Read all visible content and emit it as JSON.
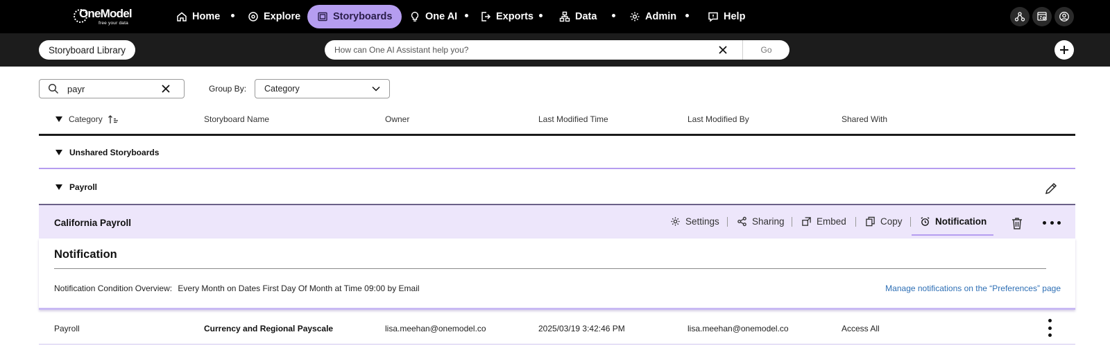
{
  "brand": {
    "name": "OneModel",
    "tagline": "free your data"
  },
  "nav": {
    "items": [
      {
        "label": "Home",
        "icon": "home-icon"
      },
      {
        "label": "Explore",
        "icon": "compass-icon"
      },
      {
        "label": "Storyboards",
        "icon": "storyboard-icon",
        "active": true
      },
      {
        "label": "One AI",
        "icon": "lightbulb-icon"
      },
      {
        "label": "Exports",
        "icon": "export-icon"
      },
      {
        "label": "Data",
        "icon": "hierarchy-icon"
      },
      {
        "label": "Admin",
        "icon": "gear-icon"
      },
      {
        "label": "Help",
        "icon": "help-chat-icon"
      }
    ],
    "right_icons": [
      "users-network-icon",
      "dashboard-settings-icon",
      "user-profile-icon"
    ]
  },
  "subbar": {
    "library_button": "Storyboard Library",
    "ai_placeholder": "How can One AI Assistant help you?",
    "go_label": "Go"
  },
  "filters": {
    "search_value": "payr",
    "group_by_label": "Group By:",
    "group_by_value": "Category"
  },
  "table": {
    "columns": [
      "Category",
      "Storyboard Name",
      "Owner",
      "Last Modified Time",
      "Last Modified By",
      "Shared With"
    ]
  },
  "groups": {
    "unshared": "Unshared Storyboards",
    "payroll": "Payroll"
  },
  "expanded": {
    "title": "California Payroll",
    "actions": {
      "settings": "Settings",
      "sharing": "Sharing",
      "embed": "Embed",
      "copy": "Copy",
      "notification": "Notification"
    },
    "section_title": "Notification",
    "overview_label": "Notification Condition Overview:",
    "overview_value": "Every Month on Dates First Day Of Month at Time 09:00 by Email",
    "manage_link": "Manage notifications on the “Preferences” page"
  },
  "row": {
    "category": "Payroll",
    "name": "Currency and Regional Payscale",
    "owner": "lisa.meehan@onemodel.co",
    "modified_time": "2025/03/19 3:42:46 PM",
    "modified_by": "lisa.meehan@onemodel.co",
    "shared_with": "Access All"
  },
  "colors": {
    "accent": "#b59df0",
    "panel_bg": "#ede6fb",
    "link": "#2e6fb5",
    "topbar": "#000000"
  }
}
